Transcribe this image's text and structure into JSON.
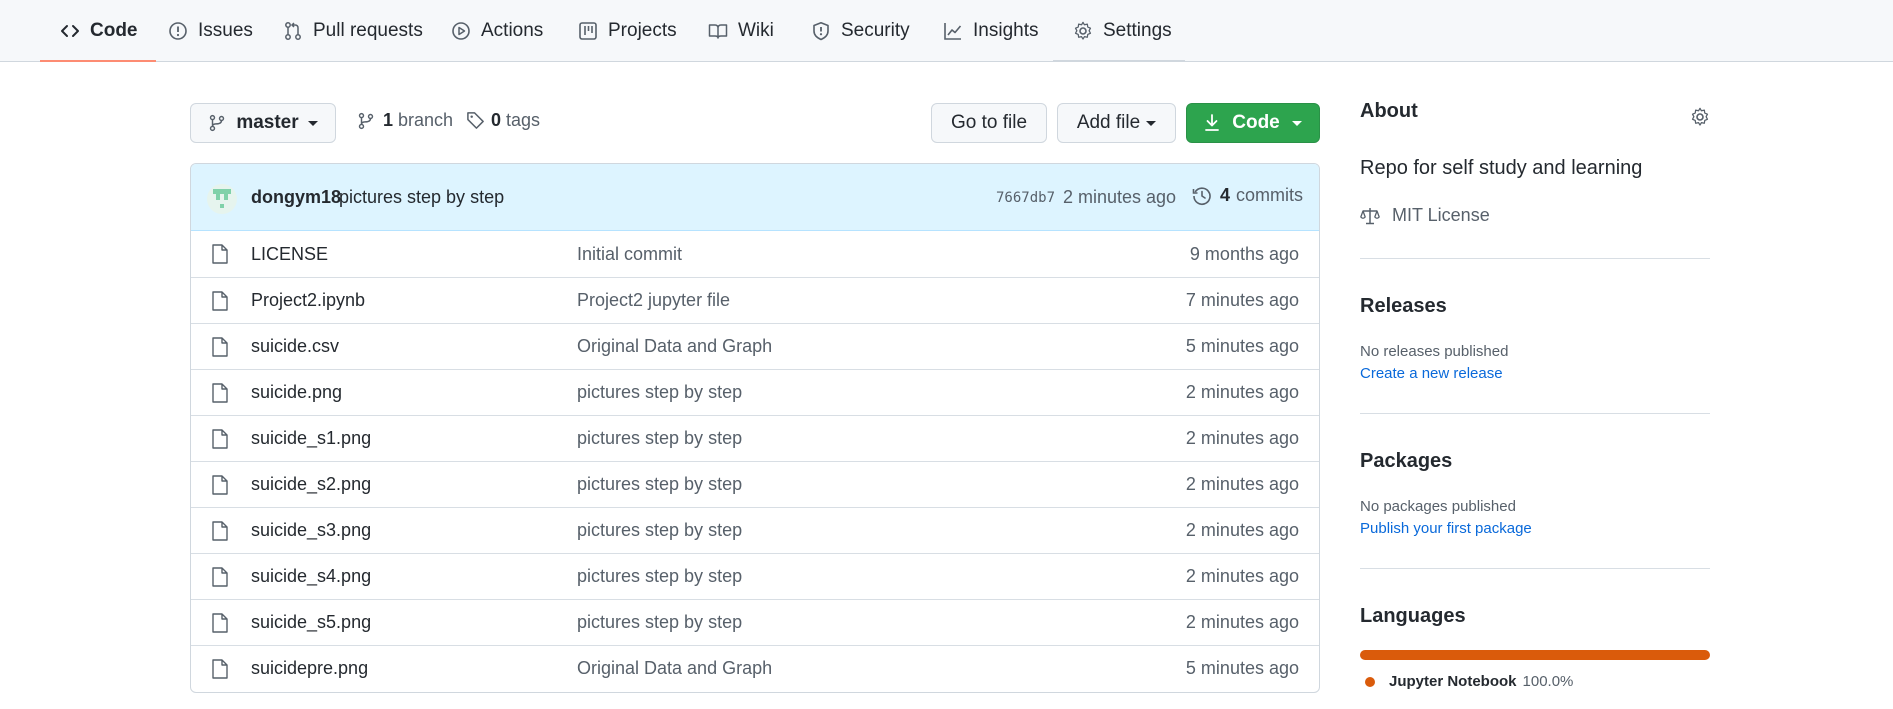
{
  "nav": {
    "tabs": [
      {
        "label": "Code",
        "icon": "code-icon"
      },
      {
        "label": "Issues",
        "icon": "issue-icon"
      },
      {
        "label": "Pull requests",
        "icon": "pull-request-icon"
      },
      {
        "label": "Actions",
        "icon": "play-icon"
      },
      {
        "label": "Projects",
        "icon": "project-icon"
      },
      {
        "label": "Wiki",
        "icon": "book-icon"
      },
      {
        "label": "Security",
        "icon": "shield-icon"
      },
      {
        "label": "Insights",
        "icon": "graph-icon"
      },
      {
        "label": "Settings",
        "icon": "gear-icon"
      }
    ],
    "selected": "Code"
  },
  "controls": {
    "branch": "master",
    "branch_count": "1",
    "branch_label": "branch",
    "tag_count": "0",
    "tag_label": "tags",
    "go_to_file": "Go to file",
    "add_file": "Add file",
    "code": "Code"
  },
  "commit": {
    "author": "dongym18",
    "message": "pictures step by step",
    "sha": "7667db7",
    "time": "2 minutes ago",
    "count": "4",
    "count_label": "commits"
  },
  "files": [
    {
      "name": "LICENSE",
      "message": "Initial commit",
      "age": "9 months ago"
    },
    {
      "name": "Project2.ipynb",
      "message": "Project2 jupyter file",
      "age": "7 minutes ago"
    },
    {
      "name": "suicide.csv",
      "message": "Original Data and Graph",
      "age": "5 minutes ago"
    },
    {
      "name": "suicide.png",
      "message": "pictures step by step",
      "age": "2 minutes ago"
    },
    {
      "name": "suicide_s1.png",
      "message": "pictures step by step",
      "age": "2 minutes ago"
    },
    {
      "name": "suicide_s2.png",
      "message": "pictures step by step",
      "age": "2 minutes ago"
    },
    {
      "name": "suicide_s3.png",
      "message": "pictures step by step",
      "age": "2 minutes ago"
    },
    {
      "name": "suicide_s4.png",
      "message": "pictures step by step",
      "age": "2 minutes ago"
    },
    {
      "name": "suicide_s5.png",
      "message": "pictures step by step",
      "age": "2 minutes ago"
    },
    {
      "name": "suicidepre.png",
      "message": "Original Data and Graph",
      "age": "5 minutes ago"
    }
  ],
  "sidebar": {
    "about_title": "About",
    "description": "Repo for self study and learning",
    "license": "MIT License",
    "releases_title": "Releases",
    "releases_none": "No releases published",
    "releases_link": "Create a new release",
    "packages_title": "Packages",
    "packages_none": "No packages published",
    "packages_link": "Publish your first package",
    "languages_title": "Languages",
    "language": {
      "name": "Jupyter Notebook",
      "percent": "100.0%",
      "share": 100,
      "color": "#da5b0b"
    }
  },
  "colors": {
    "accent_tab": "#fd8c73",
    "primary_button": "#2da44e",
    "commit_bar": "#ddf4ff",
    "link": "#0969da"
  }
}
